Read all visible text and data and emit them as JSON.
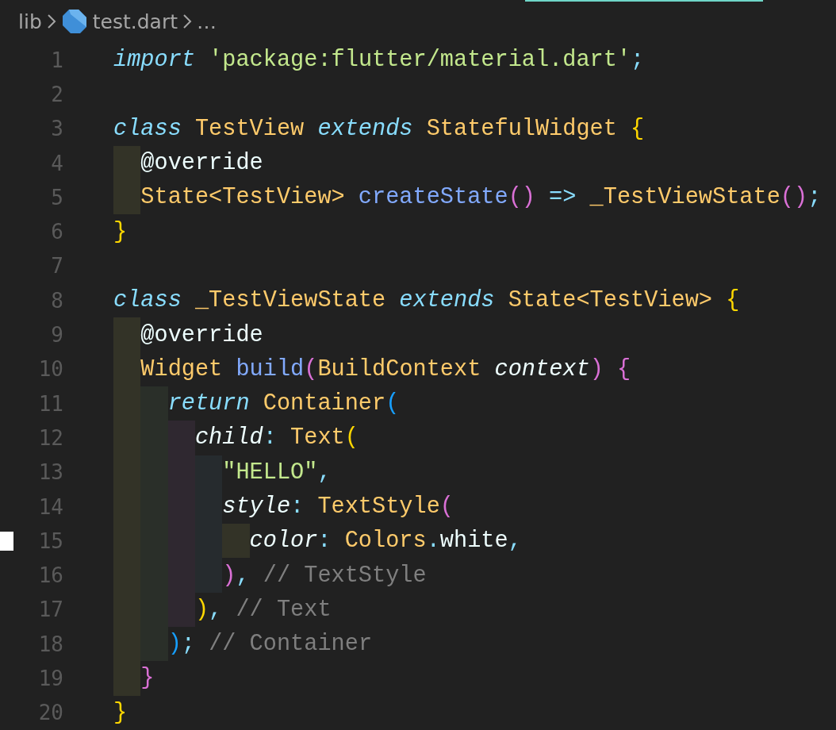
{
  "breadcrumb": [
    {
      "label": "lib",
      "kind": "folder"
    },
    {
      "label": "test.dart",
      "kind": "file"
    },
    {
      "label": "…",
      "kind": "more"
    }
  ],
  "lines": [
    {
      "number": "1",
      "marked": false,
      "tokens": [
        {
          "text": "import",
          "kind": "keyword"
        },
        {
          "text": " 'package:flutter/material.dart'",
          "kind": "string"
        },
        {
          "text": ";",
          "kind": "punct"
        }
      ]
    },
    {
      "number": "2",
      "marked": false
    },
    {
      "number": "3",
      "marked": false,
      "tokens": [
        {
          "text": "class",
          "kind": "keyword"
        },
        {
          "text": " TestView",
          "kind": "type"
        },
        {
          "text": " extends",
          "kind": "keyword"
        },
        {
          "text": " StatefulWidget",
          "kind": "type"
        },
        {
          "text": " {",
          "kind": "bracket",
          "color": "#ffd700"
        }
      ]
    },
    {
      "number": "4",
      "marked": false,
      "bands": [
        {
          "color": "#333327"
        }
      ],
      "tokens": [
        {
          "text": "@override",
          "kind": "plain"
        }
      ]
    },
    {
      "number": "5",
      "marked": false,
      "bands": [
        {
          "color": "#333327"
        }
      ],
      "tokens": [
        {
          "text": "State<TestView>",
          "kind": "type"
        },
        {
          "text": " createState",
          "kind": "function"
        },
        {
          "text": "()",
          "kind": "bracket",
          "color": "#da70d6"
        },
        {
          "text": " =>",
          "kind": "punct"
        },
        {
          "text": " _TestViewState",
          "kind": "type"
        },
        {
          "text": "()",
          "kind": "bracket",
          "color": "#da70d6"
        },
        {
          "text": ";",
          "kind": "punct"
        }
      ]
    },
    {
      "number": "6",
      "marked": false,
      "tokens": [
        {
          "text": "}",
          "kind": "bracket",
          "color": "#ffd700"
        }
      ]
    },
    {
      "number": "7",
      "marked": false
    },
    {
      "number": "8",
      "marked": false,
      "tokens": [
        {
          "text": "class",
          "kind": "keyword"
        },
        {
          "text": " _TestViewState",
          "kind": "type"
        },
        {
          "text": " extends",
          "kind": "keyword"
        },
        {
          "text": " State<TestView>",
          "kind": "type"
        },
        {
          "text": " {",
          "kind": "bracket",
          "color": "#ffd700"
        }
      ]
    },
    {
      "number": "9",
      "marked": false,
      "bands": [
        {
          "color": "#333327"
        }
      ],
      "tokens": [
        {
          "text": "@override",
          "kind": "plain"
        }
      ]
    },
    {
      "number": "10",
      "marked": false,
      "bands": [
        {
          "color": "#333327"
        }
      ],
      "tokens": [
        {
          "text": "Widget",
          "kind": "type"
        },
        {
          "text": " build",
          "kind": "function"
        },
        {
          "text": "(",
          "kind": "bracket",
          "color": "#da70d6"
        },
        {
          "text": "BuildContext",
          "kind": "type"
        },
        {
          "text": " context",
          "kind": "param"
        },
        {
          "text": ")",
          "kind": "bracket",
          "color": "#da70d6"
        },
        {
          "text": " {",
          "kind": "bracket",
          "color": "#da70d6"
        }
      ]
    },
    {
      "number": "11",
      "marked": false,
      "bands": [
        {
          "color": "#333327"
        },
        {
          "color": "#2a2f29"
        }
      ],
      "tokens": [
        {
          "text": "return",
          "kind": "keyword"
        },
        {
          "text": " Container",
          "kind": "type"
        },
        {
          "text": "(",
          "kind": "bracket",
          "color": "#179fff"
        }
      ]
    },
    {
      "number": "12",
      "marked": false,
      "bands": [
        {
          "color": "#333327"
        },
        {
          "color": "#2a2f29"
        },
        {
          "color": "#2f2830"
        }
      ],
      "tokens": [
        {
          "text": "child",
          "kind": "param"
        },
        {
          "text": ":",
          "kind": "punct"
        },
        {
          "text": " Text",
          "kind": "type"
        },
        {
          "text": "(",
          "kind": "bracket",
          "color": "#ffd700"
        }
      ]
    },
    {
      "number": "13",
      "marked": false,
      "bands": [
        {
          "color": "#333327"
        },
        {
          "color": "#2a2f29"
        },
        {
          "color": "#2f2830"
        },
        {
          "color": "#262b2e"
        }
      ],
      "tokens": [
        {
          "text": "\"HELLO\"",
          "kind": "string"
        },
        {
          "text": ",",
          "kind": "punct"
        }
      ]
    },
    {
      "number": "14",
      "marked": false,
      "bands": [
        {
          "color": "#333327"
        },
        {
          "color": "#2a2f29"
        },
        {
          "color": "#2f2830"
        },
        {
          "color": "#262b2e"
        }
      ],
      "tokens": [
        {
          "text": "style",
          "kind": "param"
        },
        {
          "text": ":",
          "kind": "punct"
        },
        {
          "text": " TextStyle",
          "kind": "type"
        },
        {
          "text": "(",
          "kind": "bracket",
          "color": "#da70d6"
        }
      ]
    },
    {
      "number": "15",
      "marked": true,
      "bands": [
        {
          "color": "#333327"
        },
        {
          "color": "#2a2f29"
        },
        {
          "color": "#2f2830"
        },
        {
          "color": "#262b2e"
        },
        {
          "color": "#333327"
        }
      ],
      "tokens": [
        {
          "text": "color",
          "kind": "param"
        },
        {
          "text": ":",
          "kind": "punct"
        },
        {
          "text": " Colors",
          "kind": "type"
        },
        {
          "text": ".",
          "kind": "punct"
        },
        {
          "text": "white",
          "kind": "plain"
        },
        {
          "text": ",",
          "kind": "punct"
        }
      ]
    },
    {
      "number": "16",
      "marked": false,
      "bands": [
        {
          "color": "#333327"
        },
        {
          "color": "#2a2f29"
        },
        {
          "color": "#2f2830"
        },
        {
          "color": "#262b2e"
        }
      ],
      "tokens": [
        {
          "text": ")",
          "kind": "bracket",
          "color": "#da70d6"
        },
        {
          "text": ",",
          "kind": "punct"
        },
        {
          "text": " // TextStyle",
          "kind": "comment"
        }
      ]
    },
    {
      "number": "17",
      "marked": false,
      "bands": [
        {
          "color": "#333327"
        },
        {
          "color": "#2a2f29"
        },
        {
          "color": "#2f2830"
        }
      ],
      "tokens": [
        {
          "text": ")",
          "kind": "bracket",
          "color": "#ffd700"
        },
        {
          "text": ",",
          "kind": "punct"
        },
        {
          "text": " // Text",
          "kind": "comment"
        }
      ]
    },
    {
      "number": "18",
      "marked": false,
      "bands": [
        {
          "color": "#333327"
        },
        {
          "color": "#2a2f29"
        }
      ],
      "tokens": [
        {
          "text": ")",
          "kind": "bracket",
          "color": "#179fff"
        },
        {
          "text": ";",
          "kind": "punct"
        },
        {
          "text": " // Container",
          "kind": "comment"
        }
      ]
    },
    {
      "number": "19",
      "marked": false,
      "bands": [
        {
          "color": "#333327"
        }
      ],
      "tokens": [
        {
          "text": "}",
          "kind": "bracket",
          "color": "#da70d6"
        }
      ]
    },
    {
      "number": "20",
      "marked": false,
      "tokens": [
        {
          "text": "}",
          "kind": "bracket",
          "color": "#ffd700"
        }
      ]
    }
  ]
}
